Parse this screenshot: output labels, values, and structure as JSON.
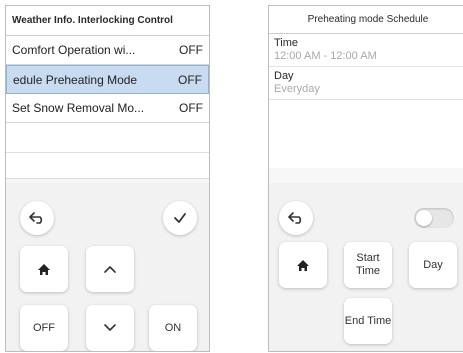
{
  "left": {
    "title": "Weather Info. Interlocking Control",
    "rows": [
      {
        "name": "Comfort Operation wi...",
        "state": "OFF"
      },
      {
        "name": "edule  Preheating Mode",
        "state": "OFF"
      },
      {
        "name": "Set Snow Removal Mo...",
        "state": "OFF"
      }
    ],
    "buttons": {
      "back": "↩",
      "confirm": "✓",
      "home": "⌂",
      "up": "⌃",
      "down": "⌄",
      "off": "OFF",
      "on": "ON"
    }
  },
  "right": {
    "title": "Preheating mode Schedule",
    "time_label": "Time",
    "time_value": "12:00 AM - 12:00 AM",
    "day_label": "Day",
    "day_value": "Everyday",
    "buttons": {
      "back": "↩",
      "start_time": "Start Time",
      "day": "Day",
      "end_time": "End Time"
    },
    "toggle_on": false
  }
}
